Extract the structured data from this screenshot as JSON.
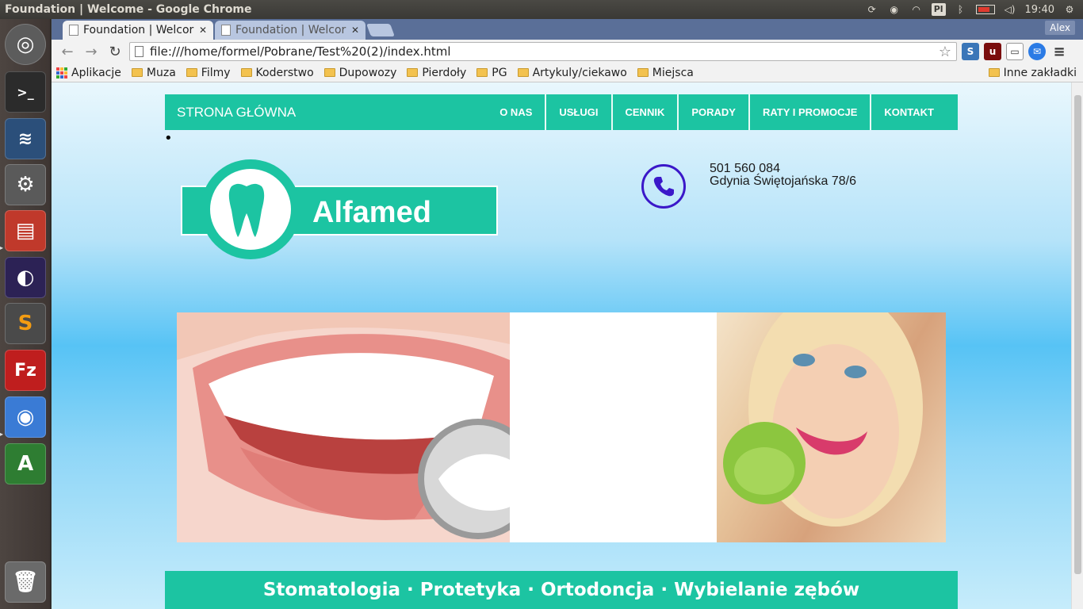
{
  "top_panel": {
    "window_title": "Foundation | Welcome - Google Chrome",
    "keyboard_layout": "Pl",
    "clock": "19:40"
  },
  "launcher": {
    "apps": [
      {
        "name": "ubuntu-dash",
        "glyph": "◎",
        "color": "#6a6a6a"
      },
      {
        "name": "terminal",
        "glyph": ">_",
        "color": "#2b2b2b"
      },
      {
        "name": "mysql-workbench",
        "glyph": "🐬",
        "color": "#2b4f7a"
      },
      {
        "name": "system-settings",
        "glyph": "⚙",
        "color": "#5a5a5a"
      },
      {
        "name": "files",
        "glyph": "▤",
        "color": "#c0392b"
      },
      {
        "name": "eclipse",
        "glyph": "◐",
        "color": "#2c2255"
      },
      {
        "name": "sublime-text",
        "glyph": "S",
        "color": "#4a4a4a"
      },
      {
        "name": "filezilla",
        "glyph": "Fz",
        "color": "#bf1e1e"
      },
      {
        "name": "chrome",
        "glyph": "◉",
        "color": "#3a7bd5"
      },
      {
        "name": "software-updater",
        "glyph": "A",
        "color": "#2e7d32"
      }
    ],
    "trash": "🗑"
  },
  "browser": {
    "tabs": [
      {
        "label": "Foundation | Welcor"
      },
      {
        "label": "Foundation | Welcor"
      }
    ],
    "user": "Alex",
    "url": "file:///home/formel/Pobrane/Test%20(2)/index.html",
    "bookmarks": [
      "Aplikacje",
      "Muza",
      "Filmy",
      "Koderstwo",
      "Dupowozy",
      "Pierdoły",
      "PG",
      "Artykuly/ciekawo",
      "Miejsca"
    ],
    "other_bookmarks": "Inne zakładki"
  },
  "page": {
    "nav": {
      "brand": "STRONA GŁÓWNA",
      "items": [
        "O NAS",
        "USŁUGI",
        "CENNIK",
        "PORADY",
        "RATY I PROMOCJE",
        "KONTAKT"
      ]
    },
    "bullet": "•",
    "logo_text": "Alfamed",
    "phone": "501 560 084",
    "address": "Gdynia Świętojańska 78/6",
    "services_line": "Stomatologia · Protetyka · Ortodoncja · Wybielanie zębów"
  },
  "colors": {
    "accent": "#1cc4a2",
    "phone_icon": "#3b18c9"
  }
}
